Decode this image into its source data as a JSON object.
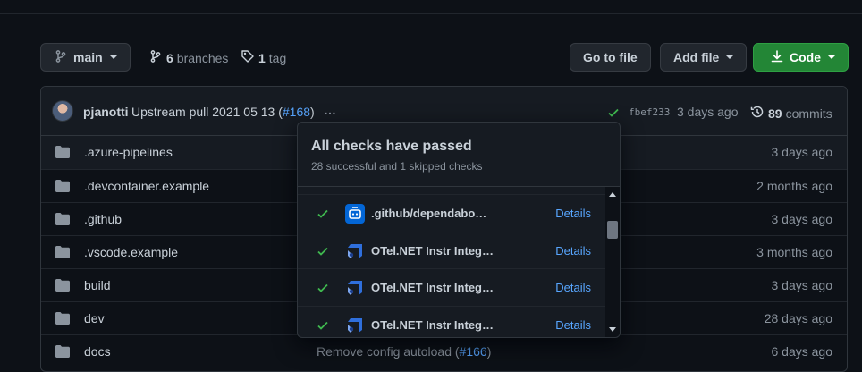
{
  "toolbar": {
    "branch_label": "main",
    "branches_count": "6",
    "branches_label": "branches",
    "tags_count": "1",
    "tags_label": "tag",
    "go_to_file": "Go to file",
    "add_file": "Add file",
    "code": "Code"
  },
  "commit": {
    "author": "pjanotti",
    "message": "Upstream pull 2021 05 13 (",
    "pr": "#168",
    "message_end": ")",
    "ellipsis": "…",
    "sha": "fbef233",
    "time": "3 days ago",
    "commits_count": "89",
    "commits_label": "commits"
  },
  "files": [
    {
      "name": ".azure-pipelines",
      "message": "",
      "pr": "",
      "time": "3 days ago"
    },
    {
      "name": ".devcontainer.example",
      "message": "",
      "pr": "",
      "time": "2 months ago"
    },
    {
      "name": ".github",
      "message": "",
      "pr": "",
      "time": "3 days ago"
    },
    {
      "name": ".vscode.example",
      "message": "",
      "pr": "",
      "time": "3 months ago"
    },
    {
      "name": "build",
      "message": "",
      "pr": "",
      "time": "3 days ago"
    },
    {
      "name": "dev",
      "message": "",
      "pr": "",
      "time": "28 days ago"
    },
    {
      "name": "docs",
      "message": "Remove config autoload (",
      "pr": "#166",
      "time": "6 days ago"
    }
  ],
  "checks_popup": {
    "title": "All checks have passed",
    "subtitle": "28 successful and 1 skipped checks",
    "checks": [
      {
        "name": ".github/dependabo…",
        "details": "Details",
        "icon": "dependabot-icon"
      },
      {
        "name": "OTel.NET Instr Integ…",
        "details": "Details",
        "icon": "azure-pipelines-icon"
      },
      {
        "name": "OTel.NET Instr Integ…",
        "details": "Details",
        "icon": "azure-pipelines-icon"
      },
      {
        "name": "OTel.NET Instr Integ…",
        "details": "Details",
        "icon": "azure-pipelines-icon"
      }
    ]
  },
  "colors": {
    "background": "#0d1117",
    "accent_green": "#238636",
    "link_blue": "#58a6ff",
    "success_green": "#3fb950"
  }
}
